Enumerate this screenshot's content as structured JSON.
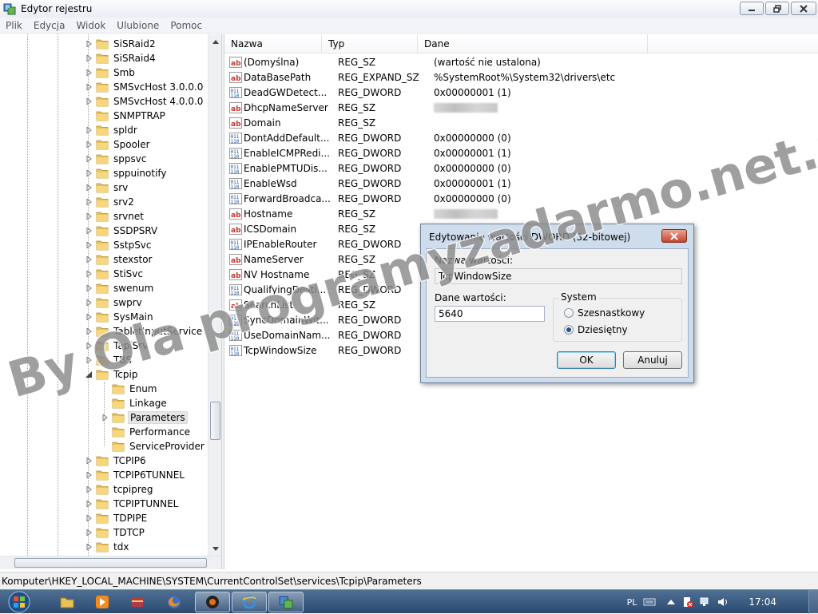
{
  "window": {
    "title": "Edytor rejestru"
  },
  "menu": [
    "Plik",
    "Edycja",
    "Widok",
    "Ulubione",
    "Pomoc"
  ],
  "tree": {
    "items": [
      {
        "label": "SiSRaid2",
        "level": 0,
        "expander": "right"
      },
      {
        "label": "SiSRaid4",
        "level": 0,
        "expander": "right"
      },
      {
        "label": "Smb",
        "level": 0,
        "expander": "right"
      },
      {
        "label": "SMSvcHost 3.0.0.0",
        "level": 0,
        "expander": "right"
      },
      {
        "label": "SMSvcHost 4.0.0.0",
        "level": 0,
        "expander": "right"
      },
      {
        "label": "SNMPTRAP",
        "level": 0,
        "expander": "none"
      },
      {
        "label": "spldr",
        "level": 0,
        "expander": "right"
      },
      {
        "label": "Spooler",
        "level": 0,
        "expander": "right"
      },
      {
        "label": "sppsvc",
        "level": 0,
        "expander": "right"
      },
      {
        "label": "sppuinotify",
        "level": 0,
        "expander": "right"
      },
      {
        "label": "srv",
        "level": 0,
        "expander": "right"
      },
      {
        "label": "srv2",
        "level": 0,
        "expander": "right"
      },
      {
        "label": "srvnet",
        "level": 0,
        "expander": "right"
      },
      {
        "label": "SSDPSRV",
        "level": 0,
        "expander": "right"
      },
      {
        "label": "SstpSvc",
        "level": 0,
        "expander": "right"
      },
      {
        "label": "stexstor",
        "level": 0,
        "expander": "right"
      },
      {
        "label": "StiSvc",
        "level": 0,
        "expander": "right"
      },
      {
        "label": "swenum",
        "level": 0,
        "expander": "right"
      },
      {
        "label": "swprv",
        "level": 0,
        "expander": "right"
      },
      {
        "label": "SysMain",
        "level": 0,
        "expander": "right"
      },
      {
        "label": "TabletInputService",
        "level": 0,
        "expander": "right"
      },
      {
        "label": "TapiSrv",
        "level": 0,
        "expander": "right"
      },
      {
        "label": "TBS",
        "level": 0,
        "expander": "right"
      },
      {
        "label": "Tcpip",
        "level": 0,
        "expander": "down"
      },
      {
        "label": "Enum",
        "level": 1,
        "expander": "none"
      },
      {
        "label": "Linkage",
        "level": 1,
        "expander": "none"
      },
      {
        "label": "Parameters",
        "level": 1,
        "expander": "right",
        "selected": true
      },
      {
        "label": "Performance",
        "level": 1,
        "expander": "none"
      },
      {
        "label": "ServiceProvider",
        "level": 1,
        "expander": "none"
      },
      {
        "label": "TCPIP6",
        "level": 0,
        "expander": "right"
      },
      {
        "label": "TCPIP6TUNNEL",
        "level": 0,
        "expander": "right"
      },
      {
        "label": "tcpipreg",
        "level": 0,
        "expander": "right"
      },
      {
        "label": "TCPIPTUNNEL",
        "level": 0,
        "expander": "right"
      },
      {
        "label": "TDPIPE",
        "level": 0,
        "expander": "right"
      },
      {
        "label": "TDTCP",
        "level": 0,
        "expander": "right"
      },
      {
        "label": "tdx",
        "level": 0,
        "expander": "right"
      }
    ]
  },
  "values": {
    "headers": [
      "Nazwa",
      "Typ",
      "Dane"
    ],
    "rows": [
      {
        "icon": "string-value-icon",
        "name": "(Domyślna)",
        "type": "REG_SZ",
        "data": "(wartość nie ustalona)"
      },
      {
        "icon": "string-value-icon",
        "name": "DataBasePath",
        "type": "REG_EXPAND_SZ",
        "data": "%SystemRoot%\\System32\\drivers\\etc"
      },
      {
        "icon": "binary-value-icon",
        "name": "DeadGWDetect...",
        "type": "REG_DWORD",
        "data": "0x00000001 (1)"
      },
      {
        "icon": "string-value-icon",
        "name": "DhcpNameServer",
        "type": "REG_SZ",
        "data": "",
        "redacted": true
      },
      {
        "icon": "string-value-icon",
        "name": "Domain",
        "type": "REG_SZ",
        "data": ""
      },
      {
        "icon": "binary-value-icon",
        "name": "DontAddDefault...",
        "type": "REG_DWORD",
        "data": "0x00000000 (0)"
      },
      {
        "icon": "binary-value-icon",
        "name": "EnableICMPRedi...",
        "type": "REG_DWORD",
        "data": "0x00000001 (1)"
      },
      {
        "icon": "binary-value-icon",
        "name": "EnablePMTUDis...",
        "type": "REG_DWORD",
        "data": "0x00000000 (0)"
      },
      {
        "icon": "binary-value-icon",
        "name": "EnableWsd",
        "type": "REG_DWORD",
        "data": "0x00000001 (1)"
      },
      {
        "icon": "binary-value-icon",
        "name": "ForwardBroadca...",
        "type": "REG_DWORD",
        "data": "0x00000000 (0)"
      },
      {
        "icon": "string-value-icon",
        "name": "Hostname",
        "type": "REG_SZ",
        "data": "",
        "redacted": true
      },
      {
        "icon": "string-value-icon",
        "name": "ICSDomain",
        "type": "REG_SZ",
        "data": ""
      },
      {
        "icon": "binary-value-icon",
        "name": "IPEnableRouter",
        "type": "REG_DWORD",
        "data": ""
      },
      {
        "icon": "string-value-icon",
        "name": "NameServer",
        "type": "REG_SZ",
        "data": ""
      },
      {
        "icon": "string-value-icon",
        "name": "NV Hostname",
        "type": "REG_SZ",
        "data": ""
      },
      {
        "icon": "binary-value-icon",
        "name": "QualifyingDesti...",
        "type": "REG_DWORD",
        "data": ""
      },
      {
        "icon": "string-value-icon",
        "name": "SearchList",
        "type": "REG_SZ",
        "data": ""
      },
      {
        "icon": "binary-value-icon",
        "name": "SyncDomainWit...",
        "type": "REG_DWORD",
        "data": ""
      },
      {
        "icon": "binary-value-icon",
        "name": "UseDomainNam...",
        "type": "REG_DWORD",
        "data": ""
      },
      {
        "icon": "binary-value-icon",
        "name": "TcpWindowSize",
        "type": "REG_DWORD",
        "data": ""
      }
    ]
  },
  "status": {
    "path": "Komputer\\HKEY_LOCAL_MACHINE\\SYSTEM\\CurrentControlSet\\services\\Tcpip\\Parameters"
  },
  "dialog": {
    "title": "Edytowanie wartości DWORD (32-bitowej)",
    "name_label": "Nazwa wartości:",
    "name_value": "TcpWindowSize",
    "data_label": "Dane wartości:",
    "data_value": "5640",
    "system_label": "System",
    "radio_hex": "Szesnastkowy",
    "radio_dec": "Dziesiętny",
    "selected_base": "dec",
    "ok": "OK",
    "cancel": "Anuluj"
  },
  "taskbar": {
    "lang": "PL",
    "time": "17:04"
  },
  "watermark": {
    "text": "By Ola programyzadarmo.net.pl"
  },
  "colors": {
    "folder": "#e8c15a",
    "taskbar": "#3a5a82",
    "watermark": "#7a7a7a"
  }
}
